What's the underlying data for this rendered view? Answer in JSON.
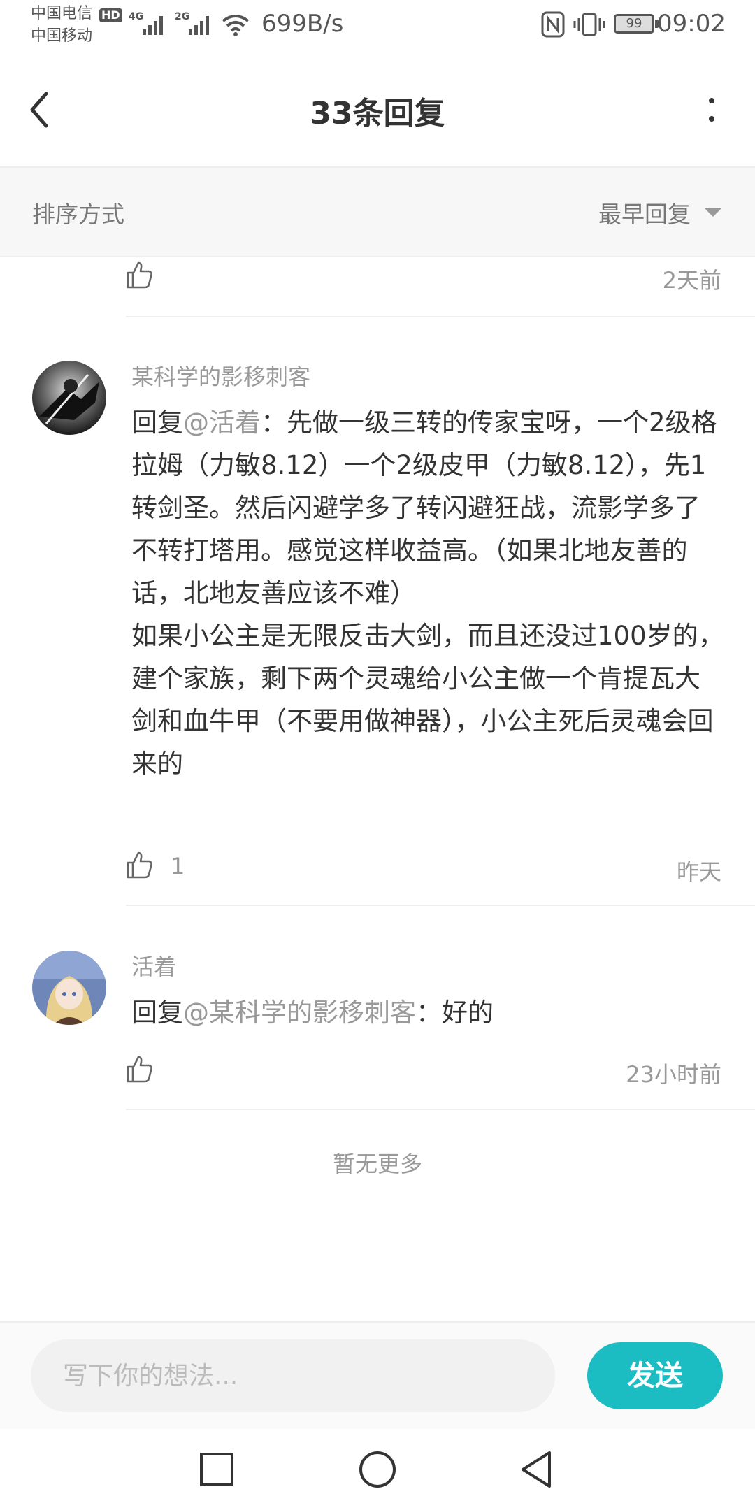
{
  "status_bar": {
    "carrier_1": "中国电信",
    "carrier_1_badge": "HD",
    "carrier_2": "中国移动",
    "signal_1_label": "4G",
    "signal_2_label": "2G",
    "net_speed": "699B/s",
    "battery": "99",
    "time": "09:02",
    "icons": [
      "nfc-icon",
      "vibrate-icon",
      "wifi-icon",
      "signal-icon",
      "battery-icon"
    ]
  },
  "header": {
    "title": "33条回复",
    "icons": [
      "back-arrow-icon",
      "more-vertical-icon"
    ]
  },
  "sort": {
    "label": "排序方式",
    "value": "最早回复"
  },
  "replies": [
    {
      "time": "2天前",
      "likes": ""
    },
    {
      "username": "某科学的影移刺客",
      "reply_prefix": "回复",
      "mention": "@活着",
      "content": "：先做一级三转的传家宝呀，一个2级格拉姆（力敏8.12）一个2级皮甲（力敏8.12），先1转剑圣。然后闪避学多了转闪避狂战，流影学多了不转打塔用。感觉这样收益高。（如果北地友善的话，北地友善应该不难）",
      "content_2": "如果小公主是无限反击大剑，而且还没过100岁的，建个家族，剩下两个灵魂给小公主做一个肯提瓦大剑和血牛甲（不要用做神器），小公主死后灵魂会回来的",
      "likes": "1",
      "time": "昨天"
    },
    {
      "username": "活着",
      "reply_prefix": "回复",
      "mention": "@某科学的影移刺客",
      "content": "：好的",
      "likes": "",
      "time": "23小时前"
    }
  ],
  "no_more_text": "暂无更多",
  "composer": {
    "placeholder": "写下你的想法...",
    "send_label": "发送"
  },
  "colors": {
    "accent": "#1cbcc3",
    "muted_text": "#999999",
    "body_text": "#333333"
  }
}
